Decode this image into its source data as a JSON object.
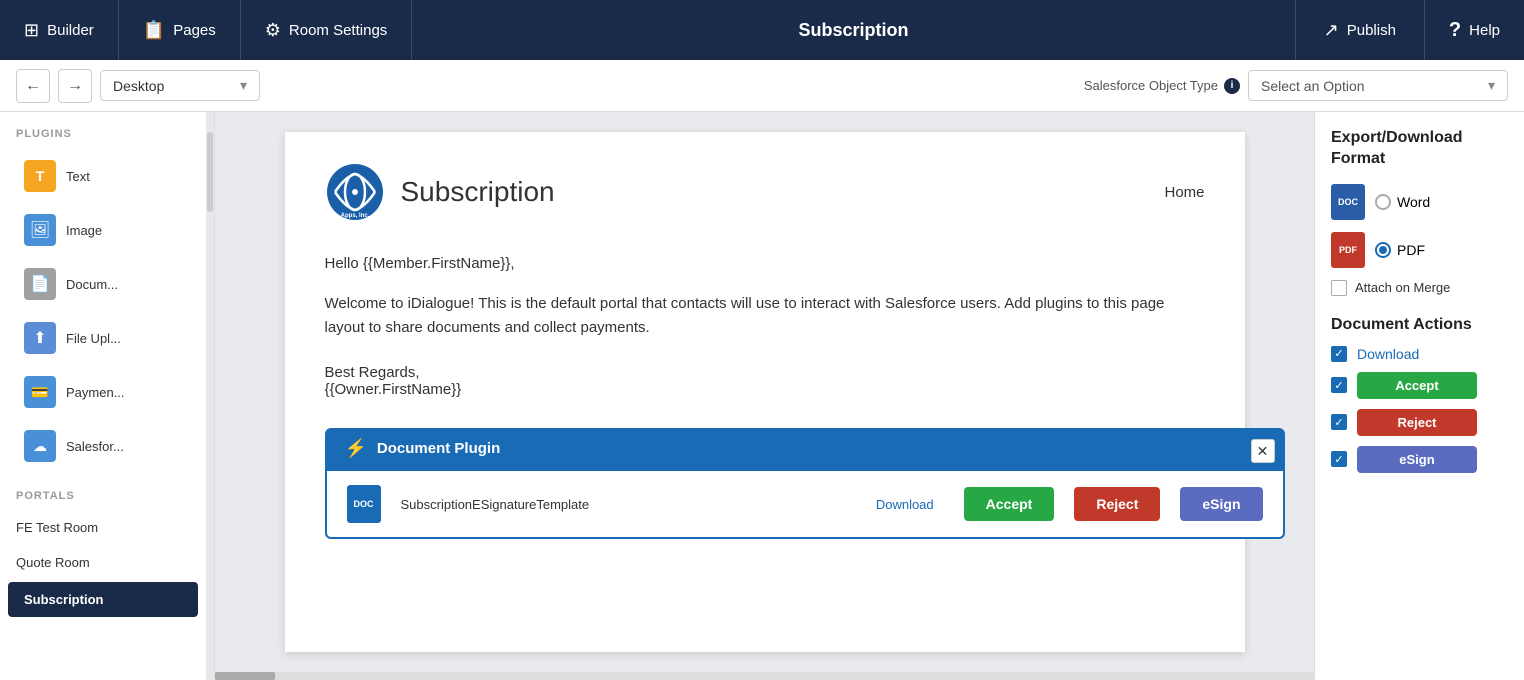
{
  "topnav": {
    "builder_label": "Builder",
    "pages_label": "Pages",
    "room_settings_label": "Room Settings",
    "page_title": "Subscription",
    "publish_label": "Publish",
    "help_label": "Help"
  },
  "toolbar": {
    "back_title": "Back",
    "forward_title": "Forward",
    "desktop_option": "Desktop",
    "sf_object_label": "Salesforce Object Type",
    "select_placeholder": "Select an Option"
  },
  "sidebar": {
    "plugins_label": "PLUGINS",
    "plugins": [
      {
        "label": "Text",
        "icon": "T"
      },
      {
        "label": "Image",
        "icon": "🖼"
      },
      {
        "label": "Docum...",
        "icon": "📄"
      },
      {
        "label": "File Upl...",
        "icon": "⬆"
      },
      {
        "label": "Paymen...",
        "icon": "💳"
      },
      {
        "label": "Salesfor...",
        "icon": "☁"
      }
    ],
    "portals_label": "PORTALS",
    "portals": [
      {
        "label": "FE Test Room",
        "active": false
      },
      {
        "label": "Quote Room",
        "active": false
      },
      {
        "label": "Subscription",
        "active": true
      }
    ]
  },
  "canvas": {
    "logo_brand": "Apps, Inc.",
    "page_heading": "Subscription",
    "home_link": "Home",
    "greeting": "Hello {{Member.FirstName}},",
    "body_text": "Welcome to iDialogue! This is the default portal that contacts will use to interact with Salesforce users. Add plugins to this page layout to share documents and collect payments.",
    "best_regards": "Best Regards,",
    "owner": "{{Owner.FirstName}}"
  },
  "document_plugin": {
    "header_label": "Document Plugin",
    "file_name": "SubscriptionESignatureTemplate",
    "download_label": "Download",
    "accept_label": "Accept",
    "reject_label": "Reject",
    "esign_label": "eSign",
    "file_ext": "DOC"
  },
  "right_panel": {
    "export_title": "Export/Download Format",
    "word_label": "Word",
    "pdf_label": "PDF",
    "pdf_selected": true,
    "attach_label": "Attach on Merge",
    "doc_actions_title": "Document Actions",
    "download_action": "Download",
    "accept_action": "Accept",
    "reject_action": "Reject",
    "esign_action": "eSign"
  }
}
